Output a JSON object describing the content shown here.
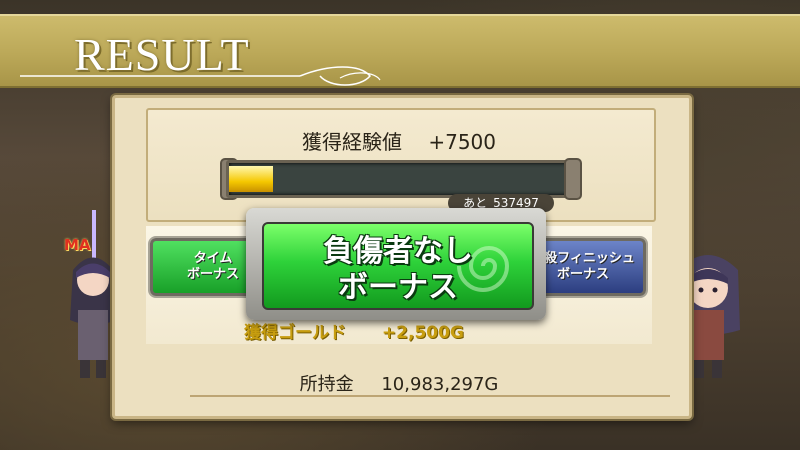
{
  "banner": {
    "title": "RESULT"
  },
  "character_left": {
    "label": "MA"
  },
  "exp": {
    "label": "獲得経験値",
    "value": "+7500",
    "bar_fill_fraction": 0.13,
    "remain_label": "あと",
    "remain_value": "537497"
  },
  "gold": {
    "earned_label": "獲得ゴールド",
    "earned_value": "+2,500G",
    "held_label": "所持金",
    "held_value": "10,983,297G"
  },
  "bonuses": {
    "time_line1": "タイム",
    "time_line2": "ボーナス",
    "main_line1": "負傷者なし",
    "main_line2": "ボーナス",
    "finish_line1": "必殺フィニッシュ",
    "finish_line2": "ボーナス"
  },
  "colors": {
    "banner": "#bba858",
    "panel": "#ece0c0",
    "bonus_green": "#2ed23a",
    "exp_fill": "#f5c800",
    "gold_text": "#c89e10"
  }
}
